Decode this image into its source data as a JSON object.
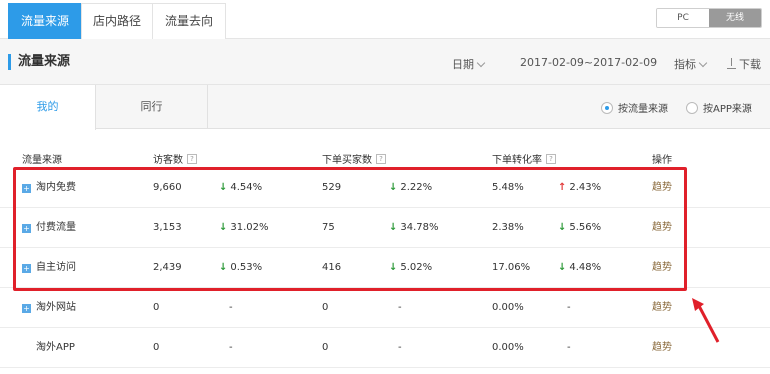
{
  "top_tabs": [
    "流量来源",
    "店内路径",
    "流量去向"
  ],
  "device_toggle": {
    "pc": "PC",
    "wireless": "无线"
  },
  "header": {
    "title": "流量来源",
    "date_label": "日期",
    "date_range": "2017-02-09~2017-02-09",
    "metric_label": "指标",
    "download_label": "下载"
  },
  "sub_tabs": {
    "mine": "我的",
    "peer": "同行"
  },
  "radios": {
    "by_source": "按流量来源",
    "by_app": "按APP来源"
  },
  "table": {
    "headers": {
      "source": "流量来源",
      "visitors": "访客数",
      "buyers": "下单买家数",
      "conversion": "下单转化率",
      "action": "操作"
    },
    "help_icon": "?",
    "rows": [
      {
        "source": "淘内免费",
        "expand": true,
        "visitors": "9,660",
        "visitors_chg": "4.54%",
        "visitors_dir": "down",
        "buyers": "529",
        "buyers_chg": "2.22%",
        "buyers_dir": "down",
        "conv": "5.48%",
        "conv_chg": "2.43%",
        "conv_dir": "up",
        "action": "趋势"
      },
      {
        "source": "付费流量",
        "expand": true,
        "visitors": "3,153",
        "visitors_chg": "31.02%",
        "visitors_dir": "down",
        "buyers": "75",
        "buyers_chg": "34.78%",
        "buyers_dir": "down",
        "conv": "2.38%",
        "conv_chg": "5.56%",
        "conv_dir": "down",
        "action": "趋势"
      },
      {
        "source": "自主访问",
        "expand": true,
        "visitors": "2,439",
        "visitors_chg": "0.53%",
        "visitors_dir": "down",
        "buyers": "416",
        "buyers_chg": "5.02%",
        "buyers_dir": "down",
        "conv": "17.06%",
        "conv_chg": "4.48%",
        "conv_dir": "down",
        "action": "趋势"
      },
      {
        "source": "淘外网站",
        "expand": true,
        "visitors": "0",
        "visitors_chg": "-",
        "visitors_dir": "",
        "buyers": "0",
        "buyers_chg": "-",
        "buyers_dir": "",
        "conv": "0.00%",
        "conv_chg": "-",
        "conv_dir": "",
        "action": "趋势"
      },
      {
        "source": "淘外APP",
        "expand": false,
        "visitors": "0",
        "visitors_chg": "-",
        "visitors_dir": "",
        "buyers": "0",
        "buyers_chg": "-",
        "buyers_dir": "",
        "conv": "0.00%",
        "conv_chg": "-",
        "conv_dir": "",
        "action": "趋势"
      }
    ]
  },
  "colors": {
    "accent": "#2d9be8",
    "up": "#e23b3b",
    "down": "#2e9a3a",
    "highlight": "#e0202a"
  }
}
